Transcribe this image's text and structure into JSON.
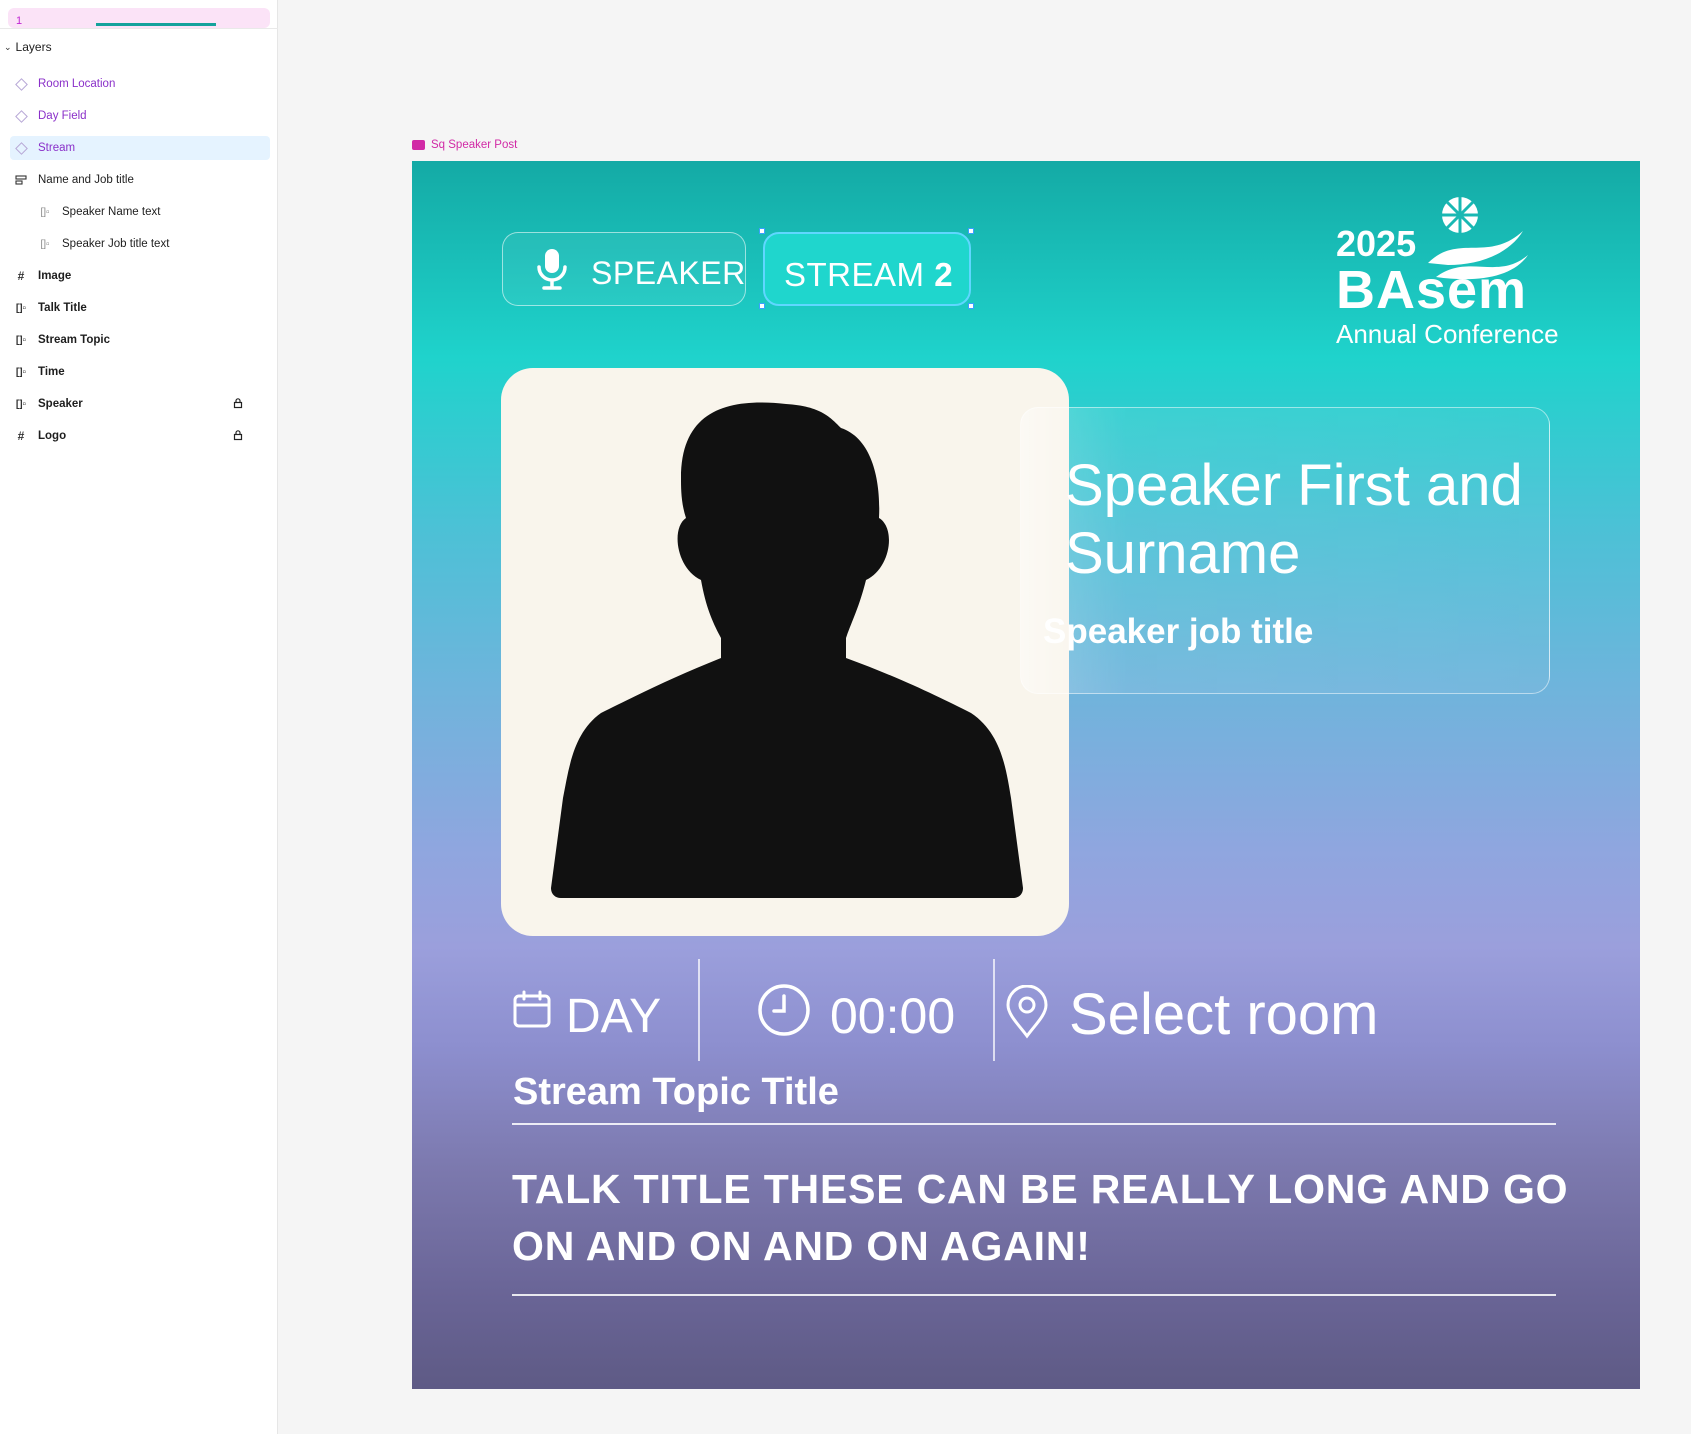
{
  "panel": {
    "page_number": "1",
    "header": "Layers",
    "layers": [
      {
        "label": "Room Location",
        "kind": "variant"
      },
      {
        "label": "Day Field",
        "kind": "variant"
      },
      {
        "label": "Stream",
        "kind": "variant",
        "selected": true
      },
      {
        "label": "Name and Job title",
        "kind": "autolayout"
      },
      {
        "label": "Speaker Name text",
        "kind": "text-child"
      },
      {
        "label": "Speaker Job title text",
        "kind": "text-child"
      },
      {
        "label": "Image",
        "kind": "frame"
      },
      {
        "label": "Talk Title",
        "kind": "component"
      },
      {
        "label": "Stream Topic",
        "kind": "component"
      },
      {
        "label": "Time",
        "kind": "component"
      },
      {
        "label": "Speaker",
        "kind": "component",
        "locked": true
      },
      {
        "label": "Logo",
        "kind": "frame",
        "locked": true
      }
    ]
  },
  "canvas": {
    "frame_label": "Sq Speaker Post",
    "speaker_pill": "SPEAKER",
    "stream_pill": {
      "prefix": "STREAM ",
      "number": "2"
    },
    "logo": {
      "year": "2025",
      "brand": "BAsem",
      "subtitle": "Annual Conference"
    },
    "speaker_name": "Speaker First and Surname",
    "speaker_job": "Speaker job title",
    "day": "DAY",
    "time": "00:00",
    "room": "Select room",
    "stream_topic": "Stream Topic Title",
    "talk_title": "TALK TITLE THESE CAN BE REALLY LONG AND GO ON AND ON AND ON AGAIN!"
  },
  "colors": {
    "accent_teal": "#1fd3cc",
    "selection_blue": "#3aa0ff",
    "frame_label_pink": "#d12aa6",
    "variant_purple": "#8a2fc9",
    "photo_bg": "#f9f5ec"
  },
  "icons": {
    "speaker_pill": "microphone-icon",
    "day": "calendar-icon",
    "time": "clock-icon",
    "room": "map-pin-icon",
    "locked_layer": "lock-icon",
    "logo_mark": "flag-globe-icon"
  }
}
